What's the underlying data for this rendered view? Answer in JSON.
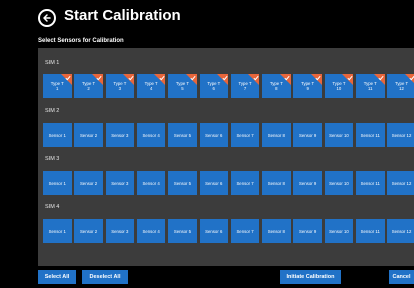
{
  "header": {
    "title": "Start Calibration"
  },
  "subtitle": "Select Sensors for Calibration",
  "sims": [
    {
      "label": "SIM 1",
      "sensors": [
        {
          "line1": "Type T",
          "line2": "1",
          "checked": true
        },
        {
          "line1": "Type T",
          "line2": "2",
          "checked": true
        },
        {
          "line1": "Type T",
          "line2": "3",
          "checked": true
        },
        {
          "line1": "Type T",
          "line2": "4",
          "checked": true
        },
        {
          "line1": "Type T",
          "line2": "5",
          "checked": true
        },
        {
          "line1": "Type T",
          "line2": "6",
          "checked": true
        },
        {
          "line1": "Type T",
          "line2": "7",
          "checked": true
        },
        {
          "line1": "Type T",
          "line2": "8",
          "checked": true
        },
        {
          "line1": "Type T",
          "line2": "9",
          "checked": true
        },
        {
          "line1": "Type T",
          "line2": "10",
          "checked": true
        },
        {
          "line1": "Type T",
          "line2": "11",
          "checked": true
        },
        {
          "line1": "Type T",
          "line2": "12",
          "checked": true
        }
      ]
    },
    {
      "label": "SIM 2",
      "sensors": [
        {
          "line1": "Sensor 1"
        },
        {
          "line1": "Sensor 2"
        },
        {
          "line1": "Sensor 3"
        },
        {
          "line1": "Sensor 4"
        },
        {
          "line1": "Sensor 5"
        },
        {
          "line1": "Sensor 6"
        },
        {
          "line1": "Sensor 7"
        },
        {
          "line1": "Sensor 8"
        },
        {
          "line1": "Sensor 9"
        },
        {
          "line1": "Sensor 10"
        },
        {
          "line1": "Sensor 11"
        },
        {
          "line1": "Sensor 12"
        }
      ]
    },
    {
      "label": "SIM 3",
      "sensors": [
        {
          "line1": "Sensor 1"
        },
        {
          "line1": "Sensor 2"
        },
        {
          "line1": "Sensor 3"
        },
        {
          "line1": "Sensor 4"
        },
        {
          "line1": "Sensor 5"
        },
        {
          "line1": "Sensor 6"
        },
        {
          "line1": "Sensor 7"
        },
        {
          "line1": "Sensor 8"
        },
        {
          "line1": "Sensor 9"
        },
        {
          "line1": "Sensor 10"
        },
        {
          "line1": "Sensor 11"
        },
        {
          "line1": "Sensor 12"
        }
      ]
    },
    {
      "label": "SIM 4",
      "sensors": [
        {
          "line1": "Sensor 1"
        },
        {
          "line1": "Sensor 2"
        },
        {
          "line1": "Sensor 3"
        },
        {
          "line1": "Sensor 4"
        },
        {
          "line1": "Sensor 5"
        },
        {
          "line1": "Sensor 6"
        },
        {
          "line1": "Sensor 7"
        },
        {
          "line1": "Sensor 8"
        },
        {
          "line1": "Sensor 9"
        },
        {
          "line1": "Sensor 10"
        },
        {
          "line1": "Sensor 11"
        },
        {
          "line1": "Sensor 12"
        }
      ]
    }
  ],
  "footer": {
    "select_all": "Select All",
    "deselect_all": "Deselect All",
    "initiate": "Initiate Calibration",
    "cancel": "Cancel"
  },
  "colors": {
    "background": "#000000",
    "panel": "#3c3c3c",
    "tile": "#2172c7",
    "check": "#e8663b"
  },
  "icons": {
    "back": "arrow-left-circle-icon",
    "selected": "checkmark-corner-icon"
  }
}
